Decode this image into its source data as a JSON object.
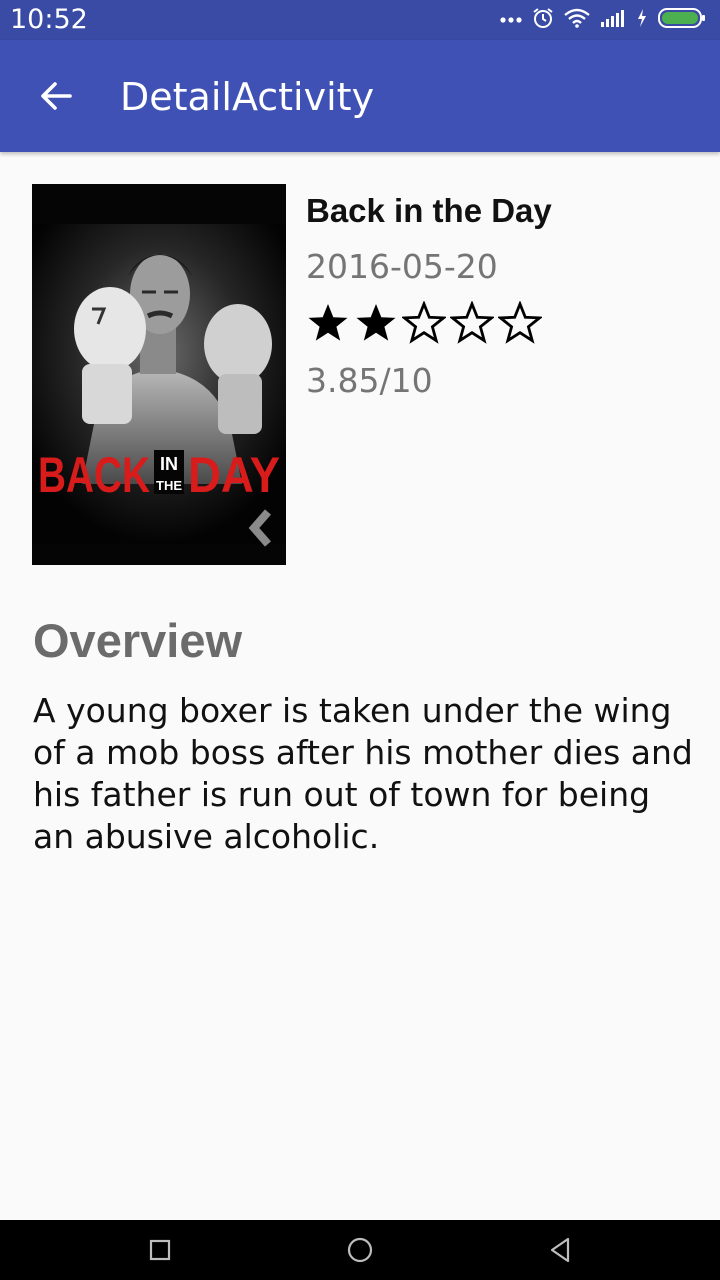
{
  "status_bar": {
    "time": "10:52",
    "icons": [
      "more-dots-icon",
      "alarm-icon",
      "wifi-icon",
      "signal-icon",
      "charging-icon",
      "battery-icon"
    ],
    "battery_color": "#4caf50"
  },
  "app_bar": {
    "title": "DetailActivity",
    "back_icon": "arrow-back-icon",
    "color": "#3f51b5"
  },
  "movie": {
    "title": "Back in the Day",
    "release_date": "2016-05-20",
    "rating_stars": {
      "filled": 2,
      "total": 5
    },
    "rating_text": "3.85/10",
    "poster": {
      "title_red": "BACK",
      "title_small_top": "IN",
      "title_small_bottom": "THE",
      "title_red_2": "DAY"
    }
  },
  "overview": {
    "heading": "Overview",
    "text": "A young boxer is taken under the wing of a mob boss after his mother dies and his father is run out of town for being an abusive alcoholic."
  },
  "nav_bar": {
    "buttons": [
      "recent-apps-icon",
      "home-icon",
      "back-icon"
    ]
  }
}
